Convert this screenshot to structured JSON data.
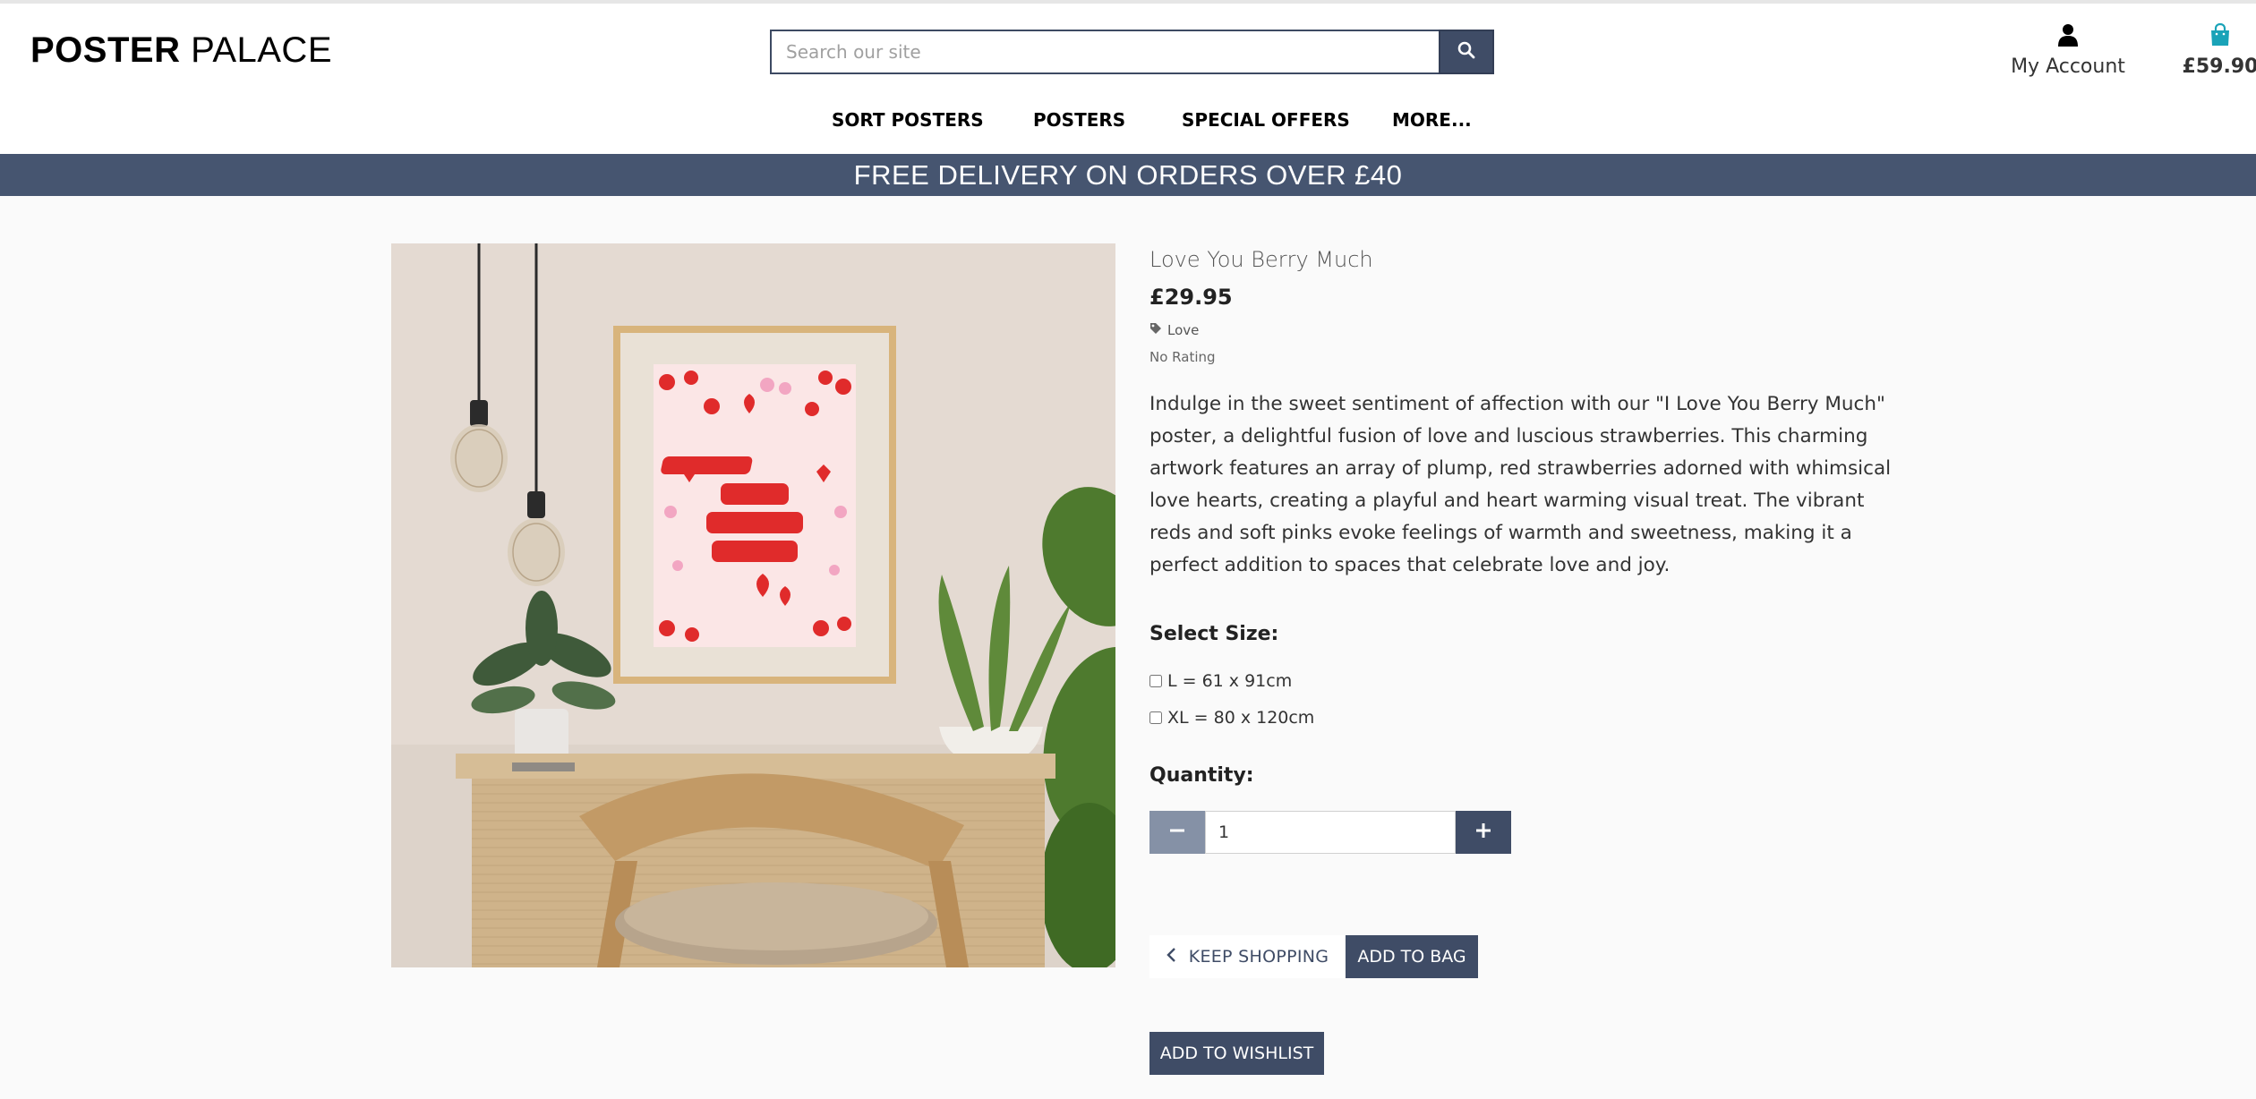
{
  "site": {
    "logo_bold": "POSTER",
    "logo_light": "PALACE"
  },
  "search": {
    "placeholder": "Search our site",
    "button_icon": "search-icon"
  },
  "account": {
    "label": "My Account",
    "icon": "user-icon"
  },
  "bag": {
    "amount": "£59.90",
    "icon": "shopping-bag-icon"
  },
  "nav": {
    "items": [
      "SORT POSTERS",
      "POSTERS",
      "SPECIAL OFFERS",
      "MORE..."
    ]
  },
  "banner": {
    "text": "FREE DELIVERY ON ORDERS OVER £40"
  },
  "product": {
    "name": "Love You Berry Much",
    "price": "£29.95",
    "category": "Love",
    "category_icon": "tag-icon",
    "rating": "No Rating",
    "description": "Indulge in the sweet sentiment of affection with our \"I Love You Berry Much\" poster, a delightful fusion of love and luscious strawberries. This charming artwork features an array of plump, red strawberries adorned with whimsical love hearts, creating a playful and heart warming visual treat. The vibrant reds and soft pinks evoke feelings of warmth and sweetness, making it a perfect addition to spaces that celebrate love and joy.",
    "poster_text": [
      "I LOVE",
      "YOU",
      "BERRY",
      "MUCH"
    ]
  },
  "size": {
    "title": "Select Size:",
    "options": [
      "L = 61 x 91cm",
      "XL = 80 x 120cm"
    ]
  },
  "quantity": {
    "title": "Quantity:",
    "value": "1"
  },
  "actions": {
    "keep_shopping": "KEEP SHOPPING",
    "add_to_bag": "ADD TO BAG",
    "add_to_wishlist": "ADD TO WISHLIST"
  },
  "colors": {
    "primary": "#3f4c66",
    "banner": "#465570",
    "bag_icon": "#1aa3b8",
    "minus_button": "#8591a6"
  }
}
